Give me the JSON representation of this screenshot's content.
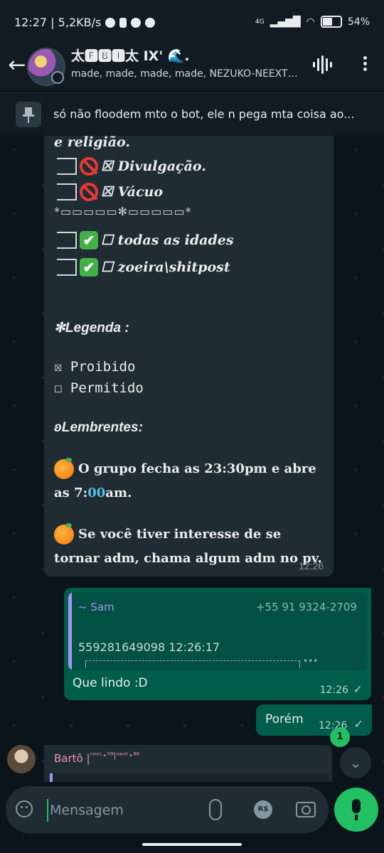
{
  "status": {
    "time_speed": "12:27 | 5,2KB/s",
    "network": "4G",
    "battery": "54%"
  },
  "header": {
    "title": "太🅵🅱🅸太 IX' 🌊.",
    "subtitle": "made, made, made, made, NEZUKO-NEEXT,..."
  },
  "pinned": {
    "text": "só não floodem mto o bot, ele n pega mta coisa ao..."
  },
  "message1": {
    "top_line": "e religião.",
    "rules": [
      {
        "label": "☒ Divulgação.",
        "icon": "prohibited-icon"
      },
      {
        "label": "☒ Vácuo",
        "icon": "prohibited-icon"
      },
      {
        "label": "☐ todas as idades",
        "icon": "check-icon"
      },
      {
        "label": "☐ zoeira\\shitpost",
        "icon": "check-icon"
      }
    ],
    "divider": "*▭▭▭▭▭✻▭▭▭▭▭*",
    "legend_title": "✻Legenda :",
    "legend_items": [
      "☒ Proibido",
      "☐ Permitido"
    ],
    "reminder_title": "ʚLembrentes:",
    "para1": "O grupo fecha as 23:30pm e abre as 7:",
    "para1_blue": "00",
    "para1_end": "am.",
    "para2": "Se você tiver interesse de se tornar adm, chama algum adm no pv.",
    "time": "12:26"
  },
  "message2": {
    "quote_name": "~ Sam",
    "quote_phone": "+55 91 9324-2709",
    "quote_text": "559281649098 12:26:17",
    "text": "Que lindo :D",
    "time": "12:26"
  },
  "message3": {
    "text": "Porém",
    "time": "12:26"
  },
  "unread_count": "1",
  "message4": {
    "sender": "Bartô |",
    "sender_tag": "ᶜᵉᵒᶜ⋆⁰⁹|ˢʷᵃᵗ⋆⁸⁶"
  },
  "composer": {
    "placeholder": "Mensagem",
    "currency": "R$"
  },
  "colors": {
    "accent": "#21c063",
    "outgoing": "#005c4b",
    "incoming": "#202c33",
    "background": "#0b141a"
  }
}
